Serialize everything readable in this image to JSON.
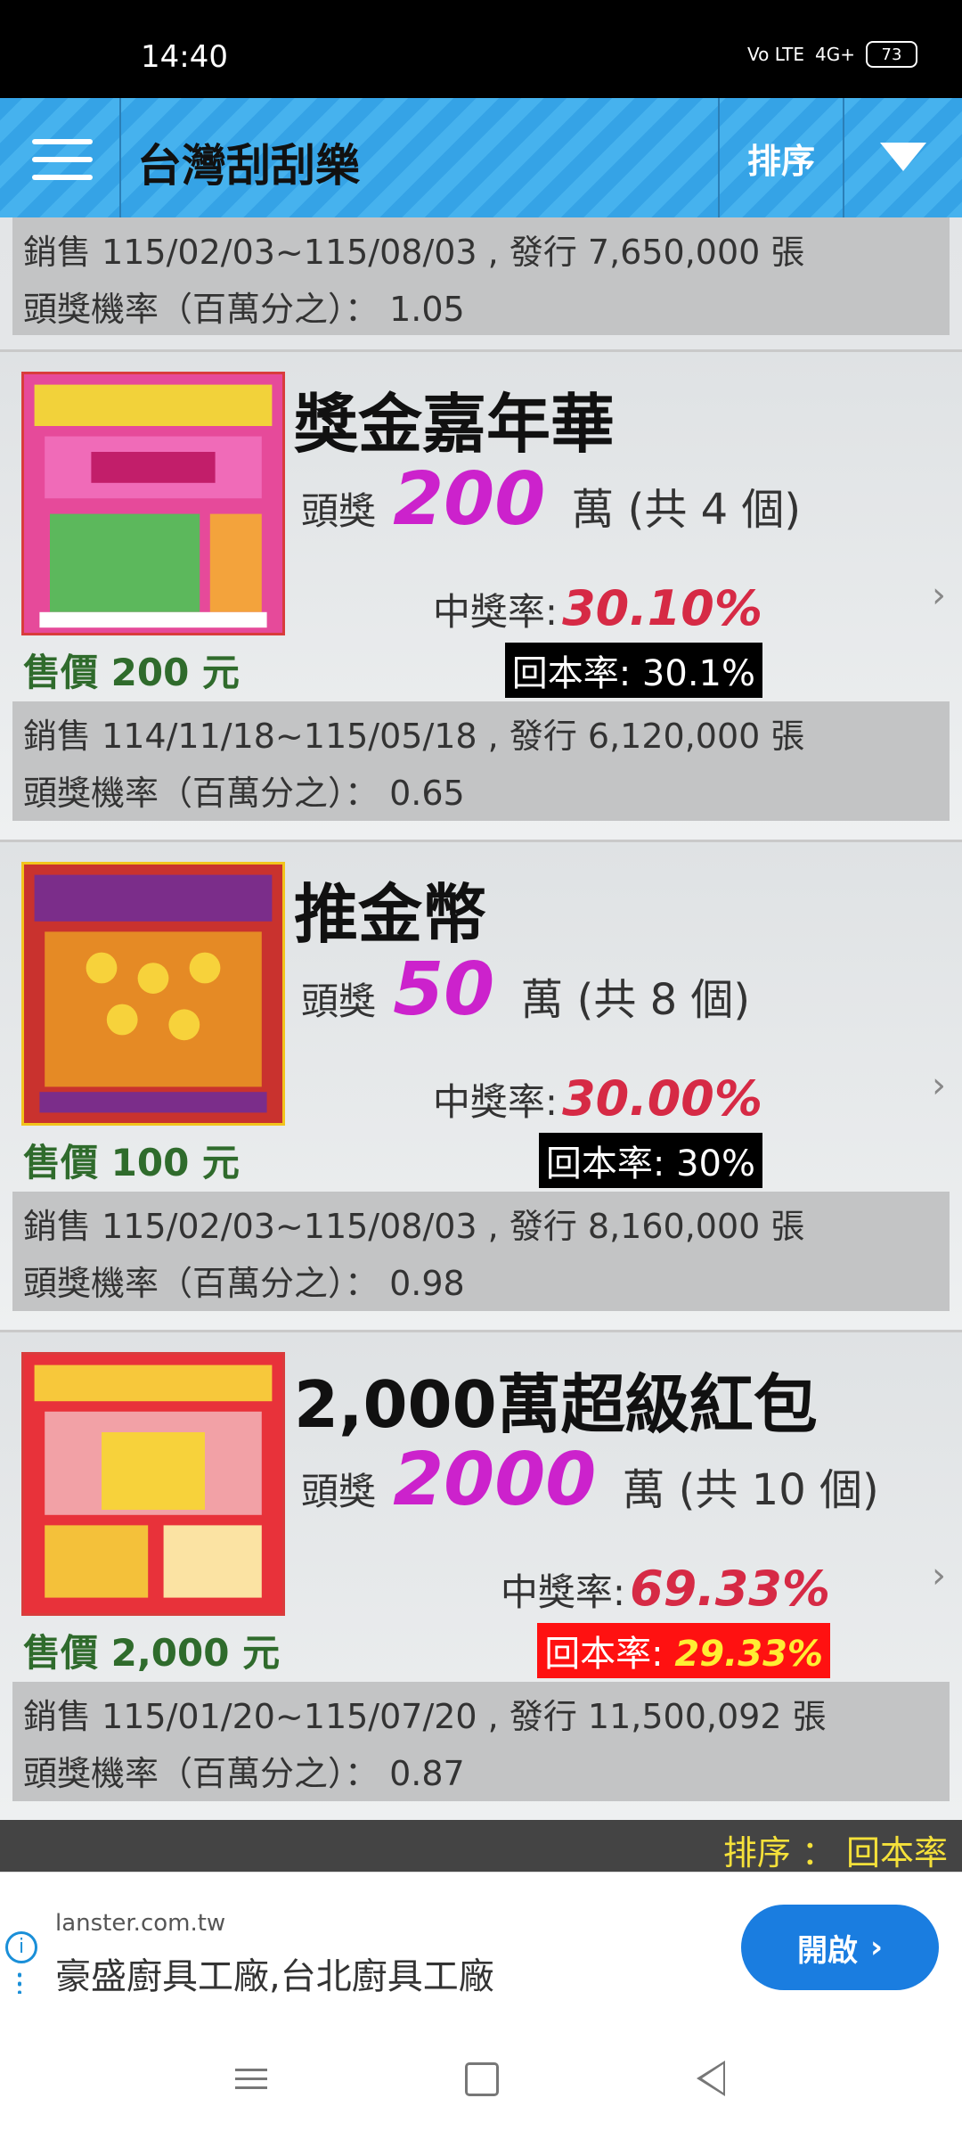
{
  "status_bar": {
    "time": "14:40",
    "network": "4G+",
    "volte": "Vo LTE",
    "battery": "73"
  },
  "app_bar": {
    "title": "台灣刮刮樂",
    "sort_label": "排序"
  },
  "partial_card": {
    "sales": "銷售 115/02/03~115/08/03 , 發行 7,650,000 張",
    "odds": "頭獎機率（百萬分之）： 1.05"
  },
  "cards": [
    {
      "name": "獎金嘉年華",
      "prize_label": "頭獎",
      "prize_amount": "200",
      "prize_unit": "萬 (共 4 個)",
      "win_rate_label": "中獎率:",
      "win_rate": "30.10%",
      "return_rate_label": "回本率:",
      "return_rate": "30.1%",
      "price": "售價 200 元",
      "sales": "銷售 114/11/18~115/05/18 , 發行 6,120,000 張",
      "odds": "頭獎機率（百萬分之）： 0.65",
      "ticket_art": "獎金嘉年華"
    },
    {
      "name": "推金幣",
      "prize_label": "頭獎",
      "prize_amount": "50",
      "prize_unit": "萬 (共 8 個)",
      "win_rate_label": "中獎率:",
      "win_rate": "30.00%",
      "return_rate_label": "回本率:",
      "return_rate": "30%",
      "price": "售價 100 元",
      "sales": "銷售 115/02/03~115/08/03 , 發行 8,160,000 張",
      "odds": "頭獎機率（百萬分之）： 0.98",
      "ticket_art": "推金幣"
    },
    {
      "name": "2,000萬超級紅包",
      "prize_label": "頭獎",
      "prize_amount": "2000",
      "prize_unit": "萬 (共 10 個)",
      "win_rate_label": "中獎率:",
      "win_rate": "69.33%",
      "return_rate_label": "回本率:",
      "return_rate": "29.33%",
      "price": "售價 2,000 元",
      "sales": "銷售 115/01/20~115/07/20 , 發行 11,500,092 張",
      "odds": "頭獎機率（百萬分之）： 0.87",
      "ticket_art": "2000萬超級紅包"
    }
  ],
  "sort_footer": "排序 ： 回本率",
  "ad": {
    "domain": "lanster.com.tw",
    "title": "豪盛廚具工廠,台北廚具工廠",
    "button": "開啟"
  },
  "colors": {
    "app_bar": "#35a3e6",
    "prize_amount": "#cc22cc",
    "win_rate": "#d62a45",
    "price": "#2f6b2c",
    "sort_footer_text": "#f5e13a",
    "ad_button": "#1a7de0"
  }
}
